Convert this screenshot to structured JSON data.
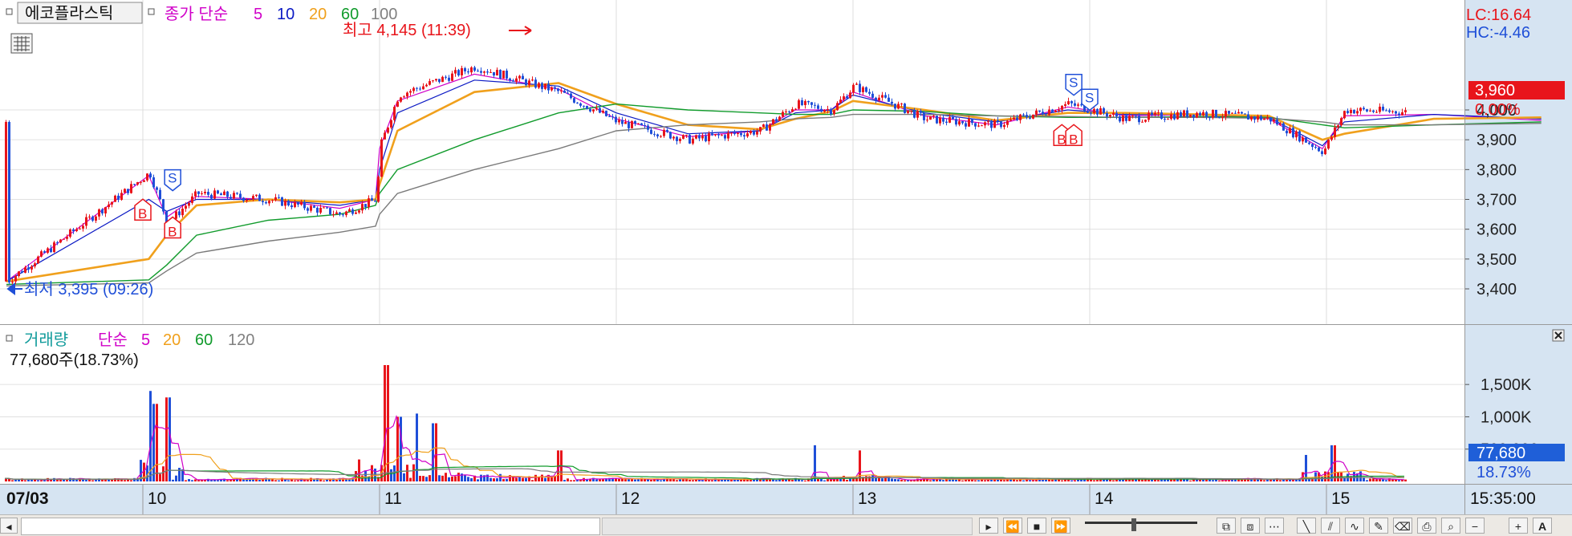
{
  "price_panel": {
    "title": "에코플라스틱",
    "legend_prefix": "종가 단순",
    "ma_periods": [
      "5",
      "10",
      "20",
      "60",
      "100"
    ],
    "high_label": "최고 4,145 (11:39)",
    "low_label": "최저 3,395 (09:26)",
    "lc": "LC:16.64",
    "hc": "HC:-4.46",
    "current_price": "3,960",
    "change_pct": "0.00%",
    "signals": [
      {
        "type": "S",
        "day": "10",
        "time": "09:50",
        "value": 3740
      },
      {
        "type": "B",
        "day": "10",
        "time": "08:00",
        "value": 3690
      },
      {
        "type": "B",
        "day": "10",
        "time": "09:50",
        "value": 3630
      },
      {
        "type": "S",
        "day": "13",
        "time": "15:10",
        "value": 4060
      },
      {
        "type": "B",
        "day": "13",
        "time": "14:50",
        "value": 3940
      },
      {
        "type": "B",
        "day": "13",
        "time": "15:10",
        "value": 3940
      },
      {
        "type": "S",
        "day": "14",
        "time": "06:00",
        "value": 4010
      }
    ]
  },
  "volume_panel": {
    "legend_title": "거래량",
    "legend_prefix": "단순",
    "ma_periods": [
      "5",
      "20",
      "60",
      "120"
    ],
    "current_volume_label": "77,680주(18.73%)",
    "current_volume": "77,680",
    "current_pct": "18.73%"
  },
  "time_axis": {
    "start_label": "07/03",
    "day_labels": [
      "10",
      "11",
      "12",
      "13",
      "14",
      "15"
    ],
    "end_time": "15:35:00"
  },
  "colors": {
    "up": "#e8151b",
    "down": "#1f4fd8",
    "ma5": "#d000c8",
    "ma10": "#0b19c4",
    "ma20": "#f0a01c",
    "ma60": "#119b2c",
    "ma100": "#7a7a7a"
  },
  "chart_data": [
    {
      "type": "candlestick",
      "title": "에코플라스틱",
      "y_ticks": [
        3400,
        3500,
        3600,
        3700,
        3800,
        3900,
        4000
      ],
      "ylim": [
        3360,
        4160
      ],
      "grid": true,
      "x_days": [
        "07/03",
        "10",
        "11",
        "12",
        "13",
        "14",
        "15"
      ],
      "close_path": [
        {
          "d": "07/03",
          "c": 3425
        },
        {
          "d": "10 09:10",
          "c": 3790
        },
        {
          "d": "10 09:40",
          "c": 3620
        },
        {
          "d": "10 10:30",
          "c": 3720
        },
        {
          "d": "10 12:30",
          "c": 3700
        },
        {
          "d": "10 14:30",
          "c": 3650
        },
        {
          "d": "10 15:30",
          "c": 3700
        },
        {
          "d": "11 09:00",
          "c": 3880
        },
        {
          "d": "11 09:30",
          "c": 4050
        },
        {
          "d": "11 11:39",
          "c": 4145
        },
        {
          "d": "11 14:00",
          "c": 4060
        },
        {
          "d": "12 09:00",
          "c": 3960
        },
        {
          "d": "12 11:00",
          "c": 3900
        },
        {
          "d": "12 13:00",
          "c": 3930
        },
        {
          "d": "12 14:00",
          "c": 4020
        },
        {
          "d": "12 15:00",
          "c": 4000
        },
        {
          "d": "13 09:00",
          "c": 4080
        },
        {
          "d": "13 11:00",
          "c": 3970
        },
        {
          "d": "13 13:00",
          "c": 3950
        },
        {
          "d": "13 15:00",
          "c": 4020
        },
        {
          "d": "14 10:00",
          "c": 3970
        },
        {
          "d": "14 12:00",
          "c": 3990
        },
        {
          "d": "14 14:00",
          "c": 3970
        },
        {
          "d": "14 15:30",
          "c": 3860
        },
        {
          "d": "15 09:30",
          "c": 4000
        },
        {
          "d": "15 12:00",
          "c": 3990
        },
        {
          "d": "15 15:00",
          "c": 3960
        }
      ],
      "series": [
        {
          "name": "5",
          "values": [
            3425,
            3780,
            3640,
            3710,
            3700,
            3670,
            3700,
            3870,
            4030,
            4120,
            4070,
            3970,
            3910,
            3930,
            4000,
            4000,
            4060,
            3980,
            3950,
            4010,
            3980,
            3985,
            3970,
            3870,
            3980,
            3985,
            3965
          ]
        },
        {
          "name": "10",
          "values": [
            3425,
            3700,
            3660,
            3700,
            3700,
            3680,
            3700,
            3800,
            3990,
            4100,
            4080,
            3990,
            3920,
            3930,
            3990,
            4000,
            4050,
            3990,
            3960,
            4000,
            3985,
            3985,
            3975,
            3880,
            3960,
            3985,
            3970
          ]
        },
        {
          "name": "20",
          "values": [
            3425,
            3500,
            3580,
            3680,
            3700,
            3690,
            3700,
            3750,
            3930,
            4060,
            4090,
            4020,
            3950,
            3935,
            3970,
            3995,
            4030,
            4000,
            3965,
            3990,
            3990,
            3985,
            3980,
            3900,
            3920,
            3970,
            3975
          ]
        },
        {
          "name": "60",
          "values": [
            3415,
            3430,
            3480,
            3580,
            3630,
            3650,
            3680,
            3720,
            3800,
            3900,
            3990,
            4020,
            4000,
            3990,
            3985,
            3985,
            4000,
            3995,
            3980,
            3975,
            3975,
            3978,
            3975,
            3950,
            3940,
            3950,
            3960
          ]
        },
        {
          "name": "100",
          "values": [
            3410,
            3420,
            3460,
            3520,
            3560,
            3590,
            3610,
            3650,
            3720,
            3800,
            3870,
            3930,
            3950,
            3960,
            3970,
            3975,
            3985,
            3985,
            3980,
            3978,
            3975,
            3975,
            3972,
            3960,
            3950,
            3950,
            3955
          ]
        }
      ]
    },
    {
      "type": "bar",
      "title": "거래량",
      "y_ticks": [
        "500,000",
        "1,000K",
        "1,500K"
      ],
      "ylim": [
        0,
        1800000
      ],
      "spikes": [
        {
          "d": "10 09:10",
          "v": 1400000
        },
        {
          "d": "10 09:20",
          "v": 1200000
        },
        {
          "d": "10 09:40",
          "v": 1300000
        },
        {
          "d": "11 09:10",
          "v": 1800000
        },
        {
          "d": "11 09:30",
          "v": 1000000
        },
        {
          "d": "11 10:00",
          "v": 1050000
        },
        {
          "d": "11 10:30",
          "v": 900000
        },
        {
          "d": "11 14:00",
          "v": 480000
        },
        {
          "d": "12 14:30",
          "v": 560000
        },
        {
          "d": "13 09:10",
          "v": 480000
        },
        {
          "d": "14 15:00",
          "v": 410000
        },
        {
          "d": "15 09:10",
          "v": 560000
        },
        {
          "d": "15 15:00",
          "v": 410000
        }
      ],
      "current": 77680
    }
  ]
}
